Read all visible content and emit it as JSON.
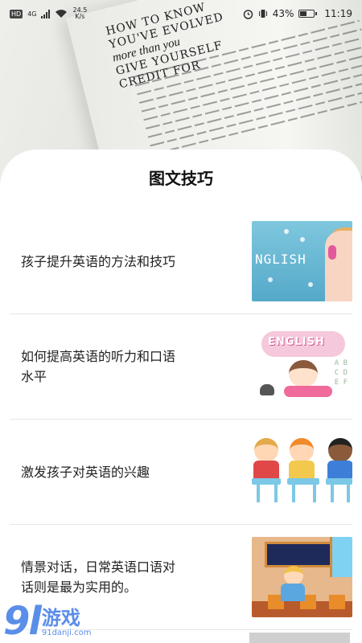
{
  "status_bar": {
    "sim": "HD",
    "network": "4G",
    "speed_value": "24.5",
    "speed_unit": "K/s",
    "battery_percent": "43%",
    "time": "11:19"
  },
  "background_book": {
    "title_line1": "HOW TO KNOW",
    "title_line2": "YOU'VE EVOLVED",
    "title_line3": "more than you",
    "title_line4": "GIVE YOURSELF",
    "title_line5": "CREDIT FOR"
  },
  "sheet": {
    "title": "图文技巧",
    "items": [
      {
        "text": "孩子提升英语的方法和技巧",
        "thumb_word": "NGLISH"
      },
      {
        "text": "如何提高英语的听力和口语水平",
        "thumb_word": "ENGLISH"
      },
      {
        "text": "激发孩子对英语的兴趣"
      },
      {
        "text": "情景对话，日常英语口语对话则是最为实用的。"
      }
    ]
  },
  "watermark": {
    "logo": "9l",
    "name": "游戏",
    "url": "91danji.com"
  }
}
